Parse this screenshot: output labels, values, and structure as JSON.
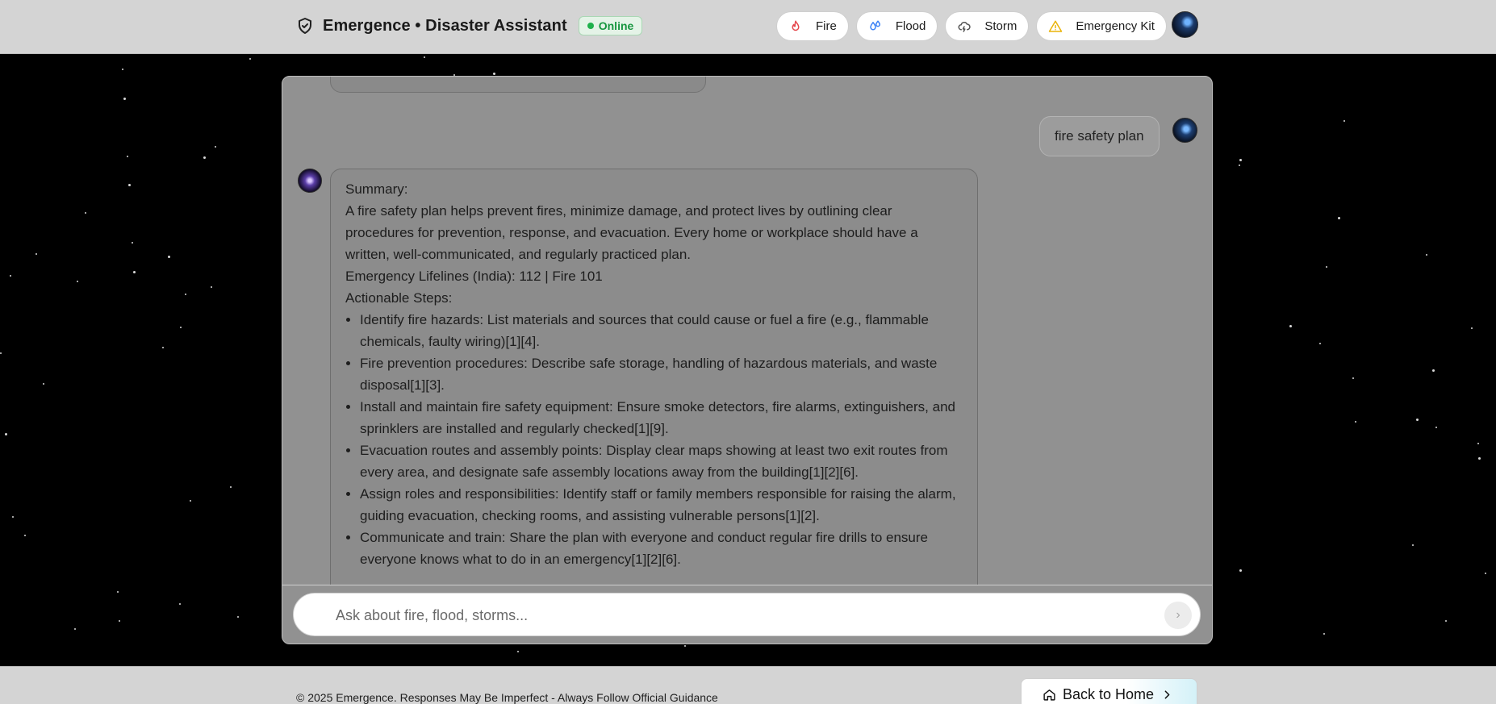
{
  "header": {
    "title": "Emergence • Disaster Assistant",
    "status": "Online",
    "nav": [
      {
        "label": "Fire",
        "icon": "flame-icon"
      },
      {
        "label": "Flood",
        "icon": "droplets-icon"
      },
      {
        "label": "Storm",
        "icon": "cloud-lightning-icon"
      },
      {
        "label": "Emergency Kit",
        "icon": "warning-triangle-icon"
      }
    ]
  },
  "chat": {
    "user_message": "fire safety plan",
    "bot_message": {
      "summary_heading": "Summary:",
      "summary_text": "A fire safety plan helps prevent fires, minimize damage, and protect lives by outlining clear procedures for prevention, response, and evacuation. Every home or workplace should have a written, well-communicated, and regularly practiced plan.",
      "lifelines": "Emergency Lifelines (India): 112 | Fire 101",
      "steps_heading": "Actionable Steps:",
      "steps": [
        "Identify fire hazards: List materials and sources that could cause or fuel a fire (e.g., flammable chemicals, faulty wiring)[1][4].",
        "Fire prevention procedures: Describe safe storage, handling of hazardous materials, and waste disposal[1][3].",
        "Install and maintain fire safety equipment: Ensure smoke detectors, fire alarms, extinguishers, and sprinklers are installed and regularly checked[1][9].",
        "Evacuation routes and assembly points: Display clear maps showing at least two exit routes from every area, and designate safe assembly locations away from the building[1][2][6].",
        "Assign roles and responsibilities: Identify staff or family members responsible for raising the alarm, guiding evacuation, checking rooms, and assisting vulnerable persons[1][2].",
        "Communicate and train: Share the plan with everyone and conduct regular fire drills to ensure everyone knows what to do in an emergency[1][2][6]."
      ]
    },
    "input": {
      "placeholder": "Ask about fire, flood, storms...",
      "value": ""
    },
    "send_icon": "›"
  },
  "footer": {
    "copyright": "© 2025 Emergence. Responses May Be Imperfect - Always Follow Official Guidance",
    "home_button": "Back to Home"
  },
  "colors": {
    "online_green": "#17963f",
    "fire_red": "#e5484d",
    "flood_blue": "#3b82f6",
    "warning_yellow": "#eab308"
  }
}
